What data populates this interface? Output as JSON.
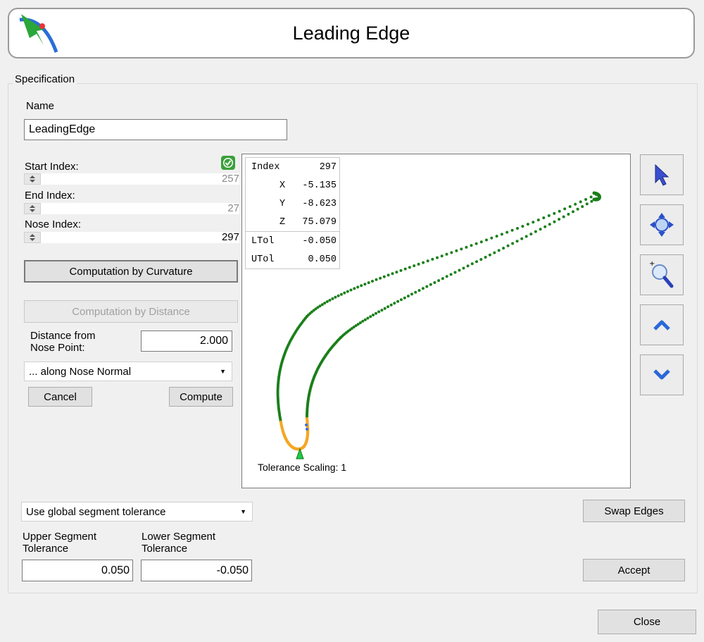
{
  "title": "Leading Edge",
  "groupbox_label": "Specification",
  "name": {
    "label": "Name",
    "value": "LeadingEdge"
  },
  "indices": {
    "start": {
      "label": "Start Index:",
      "value": "257"
    },
    "end": {
      "label": "End Index:",
      "value": "27"
    },
    "nose": {
      "label": "Nose Index:",
      "value": "297"
    }
  },
  "buttons": {
    "curvature": "Computation by Curvature",
    "distance": "Computation by Distance",
    "cancel": "Cancel",
    "compute": "Compute",
    "swap": "Swap Edges",
    "accept": "Accept",
    "close": "Close"
  },
  "distance": {
    "label_line1": "Distance from",
    "label_line2": "Nose Point:",
    "value": "2.000"
  },
  "normal_select": {
    "value": "... along Nose Normal"
  },
  "tolerance_select": {
    "value": "Use global segment tolerance"
  },
  "upper_tol": {
    "label_line1": "Upper Segment",
    "label_line2": "Tolerance",
    "value": "0.050"
  },
  "lower_tol": {
    "label_line1": "Lower Segment",
    "label_line2": "Tolerance",
    "value": "-0.050"
  },
  "info": {
    "index_label": "Index",
    "index": "297",
    "x_label": "X",
    "x": "-5.135",
    "y_label": "Y",
    "y": "-8.623",
    "z_label": "Z",
    "z": "75.079",
    "ltol_label": "LTol",
    "ltol": "-0.050",
    "utol_label": "UTol",
    "utol": "0.050"
  },
  "tolerance_scaling": "Tolerance Scaling: 1",
  "toolbar_icons": [
    "select-arrow-icon",
    "pan-icon",
    "zoom-icon",
    "chevron-up-icon",
    "chevron-down-icon"
  ],
  "colors": {
    "edge_green": "#1a7f1a",
    "leading_orange": "#f5a623",
    "nose_marker": "#22cc44"
  }
}
